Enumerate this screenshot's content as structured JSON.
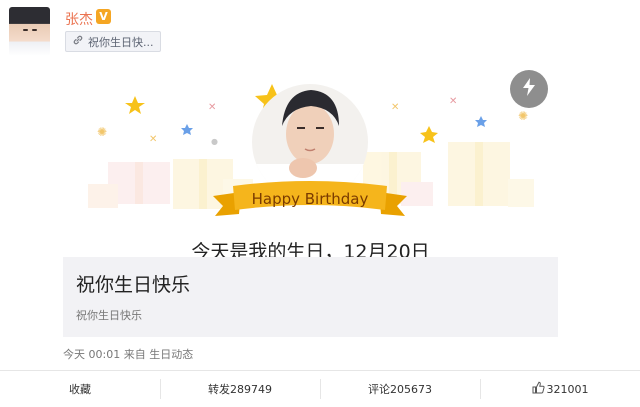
{
  "post": {
    "author": "张杰",
    "verified_badge": "V",
    "link_chip": "祝你生日快...",
    "image": {
      "banner_text": "Happy Birthday",
      "caption_partial": "今天是我的生日，12月20日"
    },
    "quote_card": {
      "title": "祝你生日快乐",
      "subtitle": "祝你生日快乐"
    },
    "meta": "今天 00:01 来自 生日动态"
  },
  "actions": {
    "favorite": "收藏",
    "repost": "转发289749",
    "comment": "评论205673",
    "like": "321001"
  },
  "icons": [
    "link-icon",
    "flash-icon",
    "thumbs-up-icon"
  ],
  "colors": {
    "username": "#eb7350",
    "badge": "#f5a623",
    "ribbon": "#f5a623",
    "star": "#f7c21a"
  }
}
